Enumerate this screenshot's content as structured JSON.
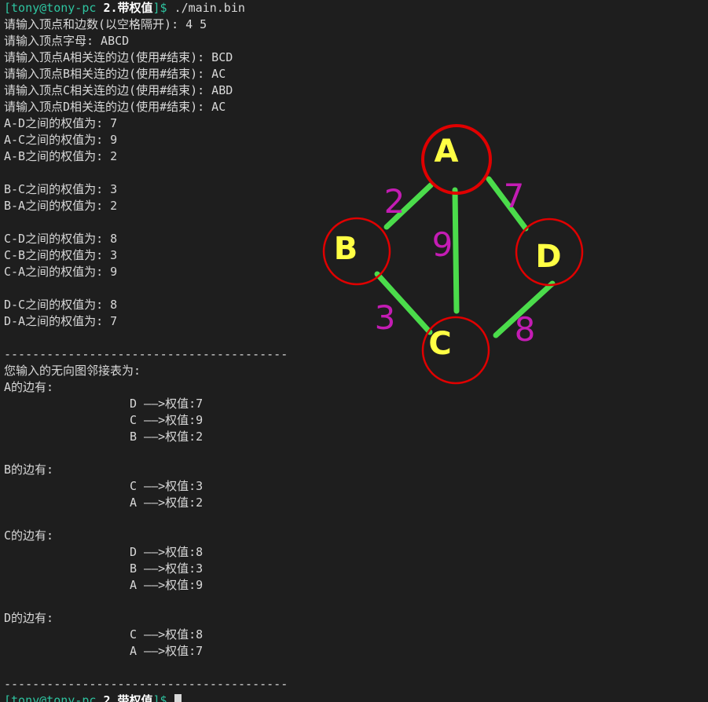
{
  "colors": {
    "background": "#1e1e1e",
    "text": "#d8d8d8",
    "prompt": "#2ec4a0",
    "node_stroke": "#e00000",
    "node_label": "#ffff44",
    "edge": "#4bdc4b",
    "weight": "#c41cb4"
  },
  "prompt": {
    "user": "[tony@tony-pc ",
    "dir": "2.带权值",
    "end": "]$ ",
    "command": "./main.bin"
  },
  "input": [
    "请输入顶点和边数(以空格隔开): 4 5",
    "请输入顶点字母: ABCD",
    "请输入顶点A相关连的边(使用#结束): BCD",
    "请输入顶点B相关连的边(使用#结束): AC",
    "请输入顶点C相关连的边(使用#结束): ABD",
    "请输入顶点D相关连的边(使用#结束): AC"
  ],
  "weight_prompts": [
    [
      "A-D之间的权值为: 7",
      "A-C之间的权值为: 9",
      "A-B之间的权值为: 2"
    ],
    [
      "B-C之间的权值为: 3",
      "B-A之间的权值为: 2"
    ],
    [
      "C-D之间的权值为: 8",
      "C-B之间的权值为: 3",
      "C-A之间的权值为: 9"
    ],
    [
      "D-C之间的权值为: 8",
      "D-A之间的权值为: 7"
    ]
  ],
  "separator": "----------------------------------------",
  "adjacency_title": "您输入的无向图邻接表为:",
  "adjacency": [
    {
      "header": "A的边有:",
      "edges": [
        "D ——>权值:7",
        "C ——>权值:9",
        "B ——>权值:2"
      ]
    },
    {
      "header": "B的边有:",
      "edges": [
        "C ——>权值:3",
        "A ——>权值:2"
      ]
    },
    {
      "header": "C的边有:",
      "edges": [
        "D ——>权值:8",
        "B ——>权值:3",
        "A ——>权值:9"
      ]
    },
    {
      "header": "D的边有:",
      "edges": [
        "C ——>权值:8",
        "A ——>权值:7"
      ]
    }
  ],
  "graph": {
    "nodes": [
      {
        "id": "A",
        "label": "A"
      },
      {
        "id": "B",
        "label": "B"
      },
      {
        "id": "C",
        "label": "C"
      },
      {
        "id": "D",
        "label": "D"
      }
    ],
    "edges": [
      {
        "from": "A",
        "to": "B",
        "weight": "2"
      },
      {
        "from": "A",
        "to": "C",
        "weight": "9"
      },
      {
        "from": "A",
        "to": "D",
        "weight": "7"
      },
      {
        "from": "B",
        "to": "C",
        "weight": "3"
      },
      {
        "from": "C",
        "to": "D",
        "weight": "8"
      }
    ]
  }
}
